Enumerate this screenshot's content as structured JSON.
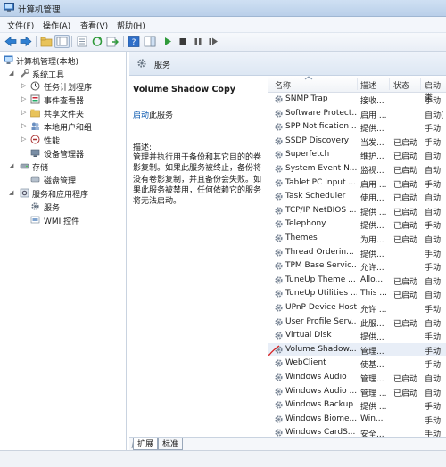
{
  "window": {
    "title": "计算机管理"
  },
  "menu": {
    "file": "文件(F)",
    "action": "操作(A)",
    "view": "查看(V)",
    "help": "帮助(H)"
  },
  "tree": {
    "root": "计算机管理(本地)",
    "system_tools": "系统工具",
    "task_scheduler": "任务计划程序",
    "event_viewer": "事件查看器",
    "shared_folders": "共享文件夹",
    "local_users": "本地用户和组",
    "performance": "性能",
    "device_manager": "设备管理器",
    "storage": "存储",
    "disk_management": "磁盘管理",
    "services_apps": "服务和应用程序",
    "services": "服务",
    "wmi": "WMI 控件"
  },
  "header": {
    "title": "服务"
  },
  "detail": {
    "service_name": "Volume Shadow Copy",
    "start_link": "启动",
    "start_suffix": "此服务",
    "desc_label": "描述:",
    "description": "管理并执行用于备份和其它目的的卷影复制。如果此服务被终止，备份将没有卷影复制，并且备份会失败。如果此服务被禁用，任何依赖它的服务将无法启动。"
  },
  "columns": {
    "name": "名称",
    "desc": "描述",
    "status": "状态",
    "startup": "启动类"
  },
  "services": [
    {
      "name": "SNMP Trap",
      "desc": "接收...",
      "status": "",
      "startup": "手动"
    },
    {
      "name": "Software Protect...",
      "desc": "启用 ...",
      "status": "",
      "startup": "自动("
    },
    {
      "name": "SPP Notification ...",
      "desc": "提供...",
      "status": "",
      "startup": "手动"
    },
    {
      "name": "SSDP Discovery",
      "desc": "当发...",
      "status": "已启动",
      "startup": "手动"
    },
    {
      "name": "Superfetch",
      "desc": "维护...",
      "status": "已启动",
      "startup": "自动"
    },
    {
      "name": "System Event N...",
      "desc": "监视...",
      "status": "已启动",
      "startup": "自动"
    },
    {
      "name": "Tablet PC Input ...",
      "desc": "启用 ...",
      "status": "已启动",
      "startup": "手动"
    },
    {
      "name": "Task Scheduler",
      "desc": "使用...",
      "status": "已启动",
      "startup": "自动"
    },
    {
      "name": "TCP/IP NetBIOS ...",
      "desc": "提供 ...",
      "status": "已启动",
      "startup": "自动"
    },
    {
      "name": "Telephony",
      "desc": "提供...",
      "status": "已启动",
      "startup": "手动"
    },
    {
      "name": "Themes",
      "desc": "为用...",
      "status": "已启动",
      "startup": "自动"
    },
    {
      "name": "Thread Orderin...",
      "desc": "提供...",
      "status": "",
      "startup": "手动"
    },
    {
      "name": "TPM Base Servic...",
      "desc": "允许...",
      "status": "",
      "startup": "手动"
    },
    {
      "name": "TuneUp Theme ...",
      "desc": "Allo...",
      "status": "已启动",
      "startup": "自动"
    },
    {
      "name": "TuneUp Utilities ...",
      "desc": "This ...",
      "status": "已启动",
      "startup": "自动"
    },
    {
      "name": "UPnP Device Host",
      "desc": "允许 ...",
      "status": "",
      "startup": "手动"
    },
    {
      "name": "User Profile Serv...",
      "desc": "此服...",
      "status": "已启动",
      "startup": "自动"
    },
    {
      "name": "Virtual Disk",
      "desc": "提供...",
      "status": "",
      "startup": "手动"
    },
    {
      "name": "Volume Shadow...",
      "desc": "管理...",
      "status": "",
      "startup": "手动"
    },
    {
      "name": "WebClient",
      "desc": "使基...",
      "status": "",
      "startup": "手动"
    },
    {
      "name": "Windows Audio",
      "desc": "管理...",
      "status": "已启动",
      "startup": "自动"
    },
    {
      "name": "Windows Audio ...",
      "desc": "管理 ...",
      "status": "已启动",
      "startup": "自动"
    },
    {
      "name": "Windows Backup",
      "desc": "提供 ...",
      "status": "",
      "startup": "手动"
    },
    {
      "name": "Windows Biome...",
      "desc": "Win...",
      "status": "",
      "startup": "手动"
    },
    {
      "name": "Windows CardS...",
      "desc": "安全...",
      "status": "",
      "startup": "手动"
    }
  ],
  "tabs": {
    "extended": "扩展",
    "standard": "标准"
  },
  "colors": {
    "accent": "#0f5bb0",
    "annotation": "#d92020"
  }
}
